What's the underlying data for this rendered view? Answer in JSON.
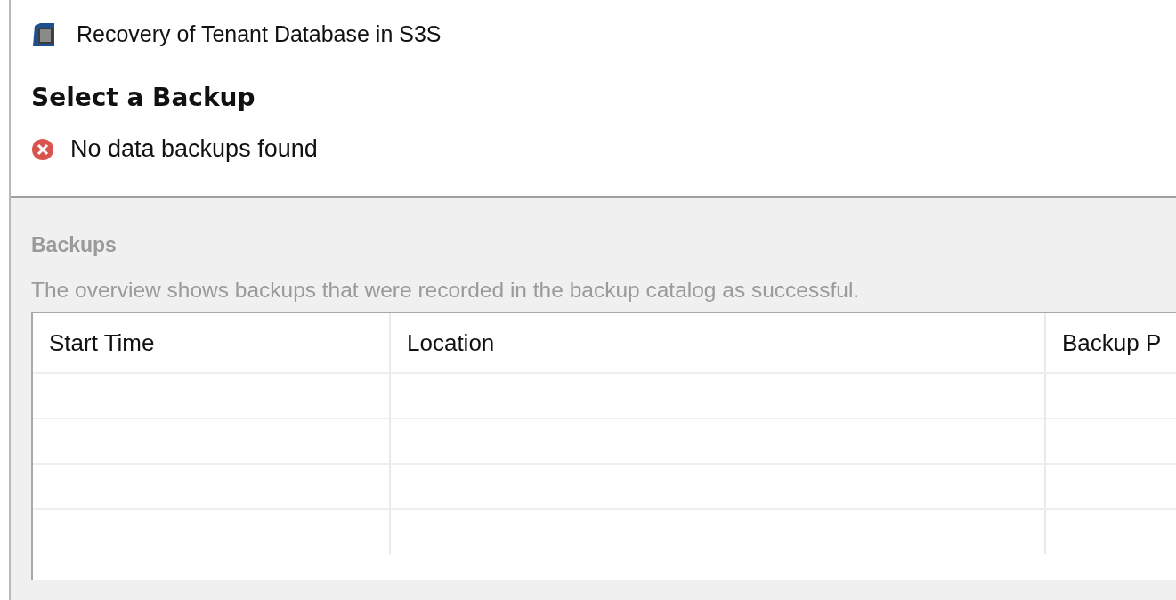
{
  "window": {
    "title": "Recovery of Tenant Database in S3S"
  },
  "page": {
    "heading": "Select a Backup",
    "message": {
      "kind": "error",
      "text": "No data backups found"
    }
  },
  "backups": {
    "title": "Backups",
    "disabled": true,
    "description": "The overview shows backups that were recorded in the backup catalog as successful.",
    "table": {
      "columns": [
        "Start Time",
        "Location",
        "Backup P"
      ]
    }
  }
}
